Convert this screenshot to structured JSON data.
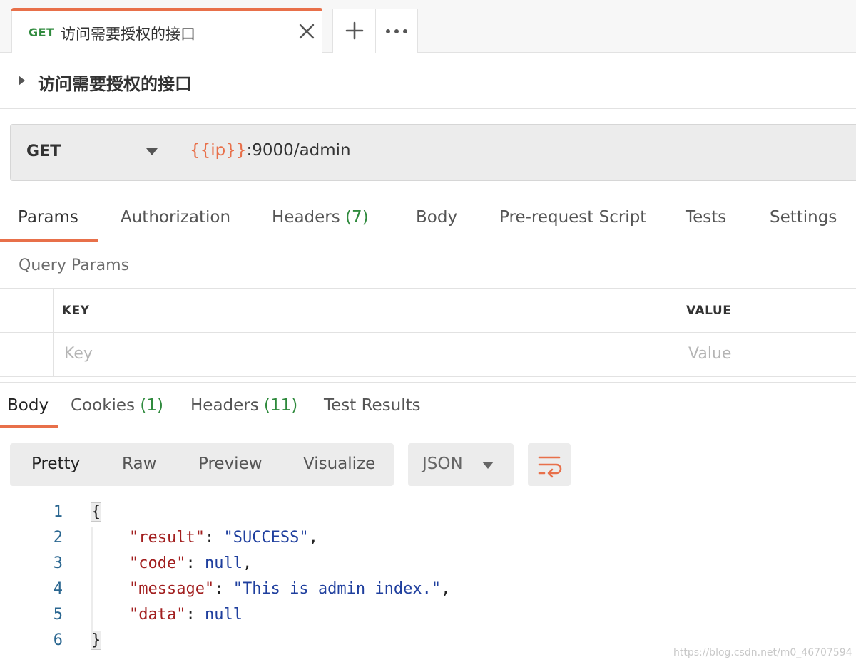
{
  "tab": {
    "method": "GET",
    "title": "访问需要授权的接口"
  },
  "request": {
    "name": "访问需要授权的接口",
    "method": "GET",
    "url_variable": "{{ip}}",
    "url_rest": ":9000/admin"
  },
  "request_tabs": [
    {
      "label": "Params",
      "count": ""
    },
    {
      "label": "Authorization",
      "count": ""
    },
    {
      "label": "Headers",
      "count": "(7)"
    },
    {
      "label": "Body",
      "count": ""
    },
    {
      "label": "Pre-request Script",
      "count": ""
    },
    {
      "label": "Tests",
      "count": ""
    },
    {
      "label": "Settings",
      "count": ""
    }
  ],
  "query_params": {
    "title": "Query Params",
    "columns": [
      "KEY",
      "VALUE"
    ],
    "key_placeholder": "Key",
    "value_placeholder": "Value"
  },
  "response_tabs": [
    {
      "label": "Body",
      "count": ""
    },
    {
      "label": "Cookies",
      "count": "(1)"
    },
    {
      "label": "Headers",
      "count": "(11)"
    },
    {
      "label": "Test Results",
      "count": ""
    }
  ],
  "view_modes": [
    "Pretty",
    "Raw",
    "Preview",
    "Visualize"
  ],
  "format": "JSON",
  "code_lines": [
    {
      "num": "1"
    },
    {
      "num": "2",
      "key": "\"result\"",
      "value": "\"SUCCESS\"",
      "tail": ","
    },
    {
      "num": "3",
      "key": "\"code\"",
      "value": "null",
      "tail": ","
    },
    {
      "num": "4",
      "key": "\"message\"",
      "value": "\"This is admin index.\"",
      "tail": ","
    },
    {
      "num": "5",
      "key": "\"data\"",
      "value": "null",
      "tail": ""
    },
    {
      "num": "6"
    }
  ],
  "code_open": "{",
  "code_close": "}",
  "watermark": "https://blog.csdn.net/m0_46707594",
  "colors": {
    "accent": "#e8704a",
    "get_green": "#2f8a3d"
  }
}
